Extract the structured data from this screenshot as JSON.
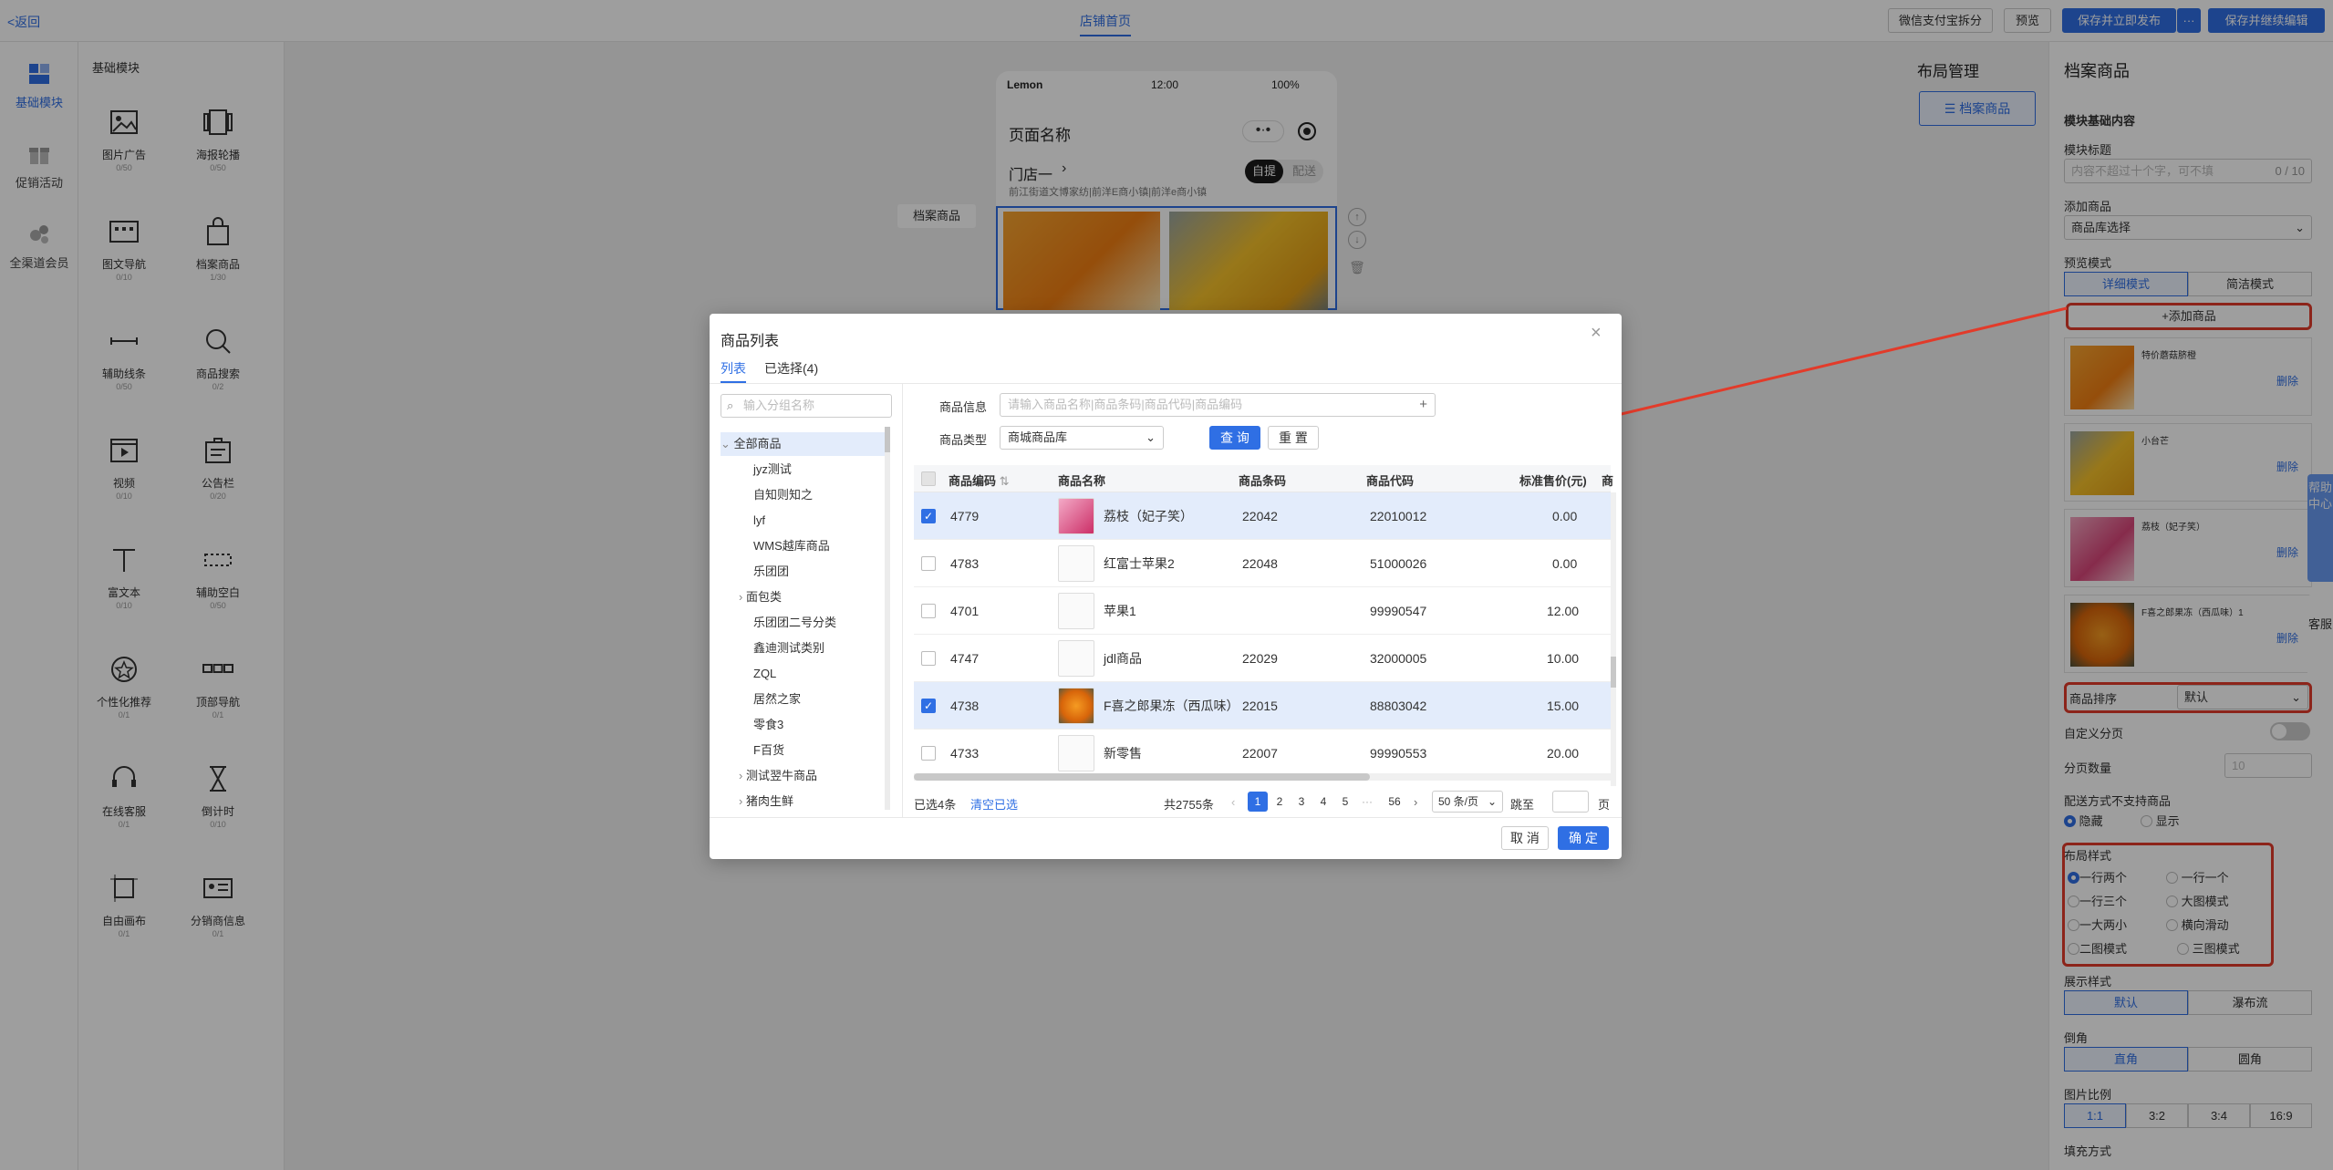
{
  "topbar": {
    "back_label": "<返回",
    "center_tab": "店铺首页",
    "buttons": [
      "微信支付宝拆分",
      "预览",
      "保存并立即发布",
      "···",
      "保存并继续编辑"
    ]
  },
  "rail": {
    "items": [
      {
        "label": "基础模块",
        "icon": "grid-icon",
        "active": true
      },
      {
        "label": "促销活动",
        "icon": "gift-icon",
        "active": false
      },
      {
        "label": "全渠道会员",
        "icon": "members-icon",
        "active": false
      }
    ]
  },
  "palette": {
    "title": "基础模块",
    "modules": [
      {
        "label": "图片广告",
        "count": "0/50",
        "icon": "image-icon"
      },
      {
        "label": "海报轮播",
        "count": "0/50",
        "icon": "carousel-icon"
      },
      {
        "label": "图文导航",
        "count": "0/10",
        "icon": "image-nav-icon"
      },
      {
        "label": "档案商品",
        "count": "1/30",
        "icon": "bag-icon"
      },
      {
        "label": "辅助线条",
        "count": "0/50",
        "icon": "line-icon"
      },
      {
        "label": "商品搜索",
        "count": "0/2",
        "icon": "search-icon"
      },
      {
        "label": "视频",
        "count": "0/10",
        "icon": "video-icon"
      },
      {
        "label": "公告栏",
        "count": "0/20",
        "icon": "notice-icon"
      },
      {
        "label": "富文本",
        "count": "0/10",
        "icon": "text-icon"
      },
      {
        "label": "辅助空白",
        "count": "0/50",
        "icon": "blank-icon"
      },
      {
        "label": "个性化推荐",
        "count": "0/1",
        "icon": "star-icon"
      },
      {
        "label": "顶部导航",
        "count": "0/1",
        "icon": "top-nav-icon"
      },
      {
        "label": "在线客服",
        "count": "0/1",
        "icon": "headset-icon"
      },
      {
        "label": "倒计时",
        "count": "0/10",
        "icon": "hourglass-icon"
      },
      {
        "label": "自由画布",
        "count": "0/1",
        "icon": "canvas-icon"
      },
      {
        "label": "分销商信息",
        "count": "0/1",
        "icon": "id-card-icon"
      }
    ]
  },
  "phone": {
    "carrier": "Lemon",
    "time": "12:00",
    "battery": "100%",
    "page_name": "页面名称",
    "store": "门店一",
    "address": "前江街道文博家纺|前洋E商小镇|前洋e商小镇",
    "pickup": "自提",
    "delivery": "配送",
    "module_tag": "档案商品"
  },
  "layout_panel": {
    "title": "布局管理",
    "item": "档案商品"
  },
  "right_panel": {
    "title": "档案商品",
    "section": "模块基础内容",
    "module_title_label": "模块标题",
    "module_title_placeholder": "内容不超过十个字，可不填",
    "module_title_counter": "0 / 10",
    "add_goods_label": "添加商品",
    "add_goods_value": "商品库选择",
    "preview_label": "预览模式",
    "preview_modes": [
      "详细模式",
      "简洁模式"
    ],
    "add_button": "+添加商品",
    "goods": [
      {
        "name": "特价蘑菇脐橙",
        "action": "删除"
      },
      {
        "name": "小台芒",
        "action": "删除"
      },
      {
        "name": "荔枝（妃子笑）",
        "action": "删除"
      },
      {
        "name": "F喜之郎果冻（西瓜味）1",
        "action": "删除"
      }
    ],
    "sort_label": "商品排序",
    "sort_value": "默认",
    "custom_paging": "自定义分页",
    "page_count_label": "分页数量",
    "page_count_value": "10",
    "unsupported_label": "配送方式不支持商品",
    "unsupported_options": [
      "隐藏",
      "显示"
    ],
    "layout_style_label": "布局样式",
    "layout_options": [
      "一行两个",
      "一行一个",
      "一行三个",
      "大图模式",
      "一大两小",
      "横向滑动",
      "二图模式",
      "三图模式"
    ],
    "display_label": "展示样式",
    "display_options": [
      "默认",
      "瀑布流"
    ],
    "corner_label": "倒角",
    "corner_options": [
      "直角",
      "圆角"
    ],
    "ratio_label": "图片比例",
    "ratio_options": [
      "1:1",
      "3:2",
      "3:4",
      "16:9"
    ],
    "fill_label": "填充方式"
  },
  "side_float": {
    "help": "帮助中心",
    "service": "客服"
  },
  "modal": {
    "title": "商品列表",
    "tabs": [
      "列表",
      "已选择(4)"
    ],
    "category_search_placeholder": "输入分组名称",
    "categories": [
      "全部商品",
      "jyz测试",
      "自知则知之",
      "lyf",
      "WMS越库商品",
      "乐团团",
      "面包类",
      "乐团团二号分类",
      "鑫迪测试类别",
      "ZQL",
      "居然之家",
      "零食3",
      "F百货",
      "测试翌牛商品",
      "猪肉生鲜"
    ],
    "filter_info_label": "商品信息",
    "filter_info_placeholder": "请输入商品名称|商品条码|商品代码|商品编码",
    "filter_type_label": "商品类型",
    "filter_type_value": "商城商品库",
    "query_button": "查 询",
    "reset_button": "重 置",
    "columns": [
      "商品编码",
      "商品名称",
      "商品条码",
      "商品代码",
      "标准售价(元)",
      "商"
    ],
    "rows": [
      {
        "code": "4779",
        "name": "荔枝（妃子笑）",
        "barcode": "22042",
        "sku": "22010012",
        "price": "0.00",
        "checked": true
      },
      {
        "code": "4783",
        "name": "红富士苹果2",
        "barcode": "22048",
        "sku": "51000026",
        "price": "0.00",
        "checked": false
      },
      {
        "code": "4701",
        "name": "苹果1",
        "barcode": "",
        "sku": "99990547",
        "price": "12.00",
        "checked": false
      },
      {
        "code": "4747",
        "name": "jdl商品",
        "barcode": "22029",
        "sku": "32000005",
        "price": "10.00",
        "checked": false
      },
      {
        "code": "4738",
        "name": "F喜之郎果冻（西瓜味）",
        "barcode": "22015",
        "sku": "88803042",
        "price": "15.00",
        "checked": true
      },
      {
        "code": "4733",
        "name": "新零售",
        "barcode": "22007",
        "sku": "99990553",
        "price": "20.00",
        "checked": false
      }
    ],
    "selected_text": "已选4条",
    "clear_text": "清空已选",
    "total_text": "共2755条",
    "pages": [
      "1",
      "2",
      "3",
      "4",
      "5",
      "···",
      "56"
    ],
    "page_size": "50 条/页",
    "jump_label": "跳至",
    "page_unit": "页",
    "cancel_button": "取 消",
    "ok_button": "确 定"
  },
  "colors": {
    "accent": "#2f6fe4",
    "highlight": "#e23b2a",
    "selected_row": "#e3ecfb"
  }
}
